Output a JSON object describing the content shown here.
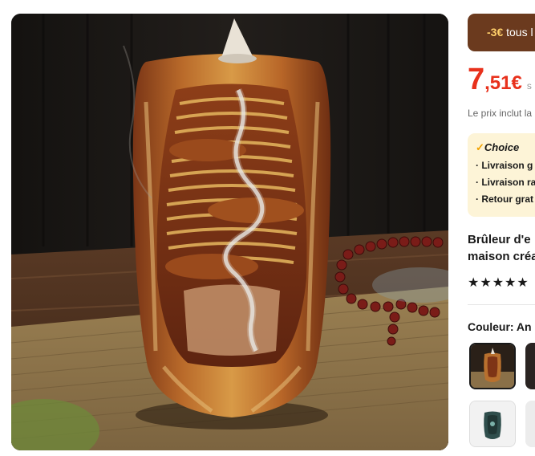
{
  "product_image": {
    "alt_icon": "incense-burner-photo"
  },
  "promo": {
    "discount": "-3€",
    "text": " tous l"
  },
  "price": {
    "integer": "7",
    "decimal": ",51€",
    "old_fragment": "s"
  },
  "tax_note": "Le prix inclut la",
  "choice": {
    "badge": "Choice",
    "items": [
      "· Livraison g",
      "· Livraison ra",
      "· Retour grat"
    ]
  },
  "title": {
    "line1": "Brûleur d'e",
    "line2": "maison créa"
  },
  "rating": {
    "stars": "★★★★★"
  },
  "color": {
    "label": "Couleur: An"
  },
  "colors": {
    "brand_red": "#e8311c",
    "promo_brown": "#6b3a1e",
    "choice_bg": "#fdf4d7"
  }
}
